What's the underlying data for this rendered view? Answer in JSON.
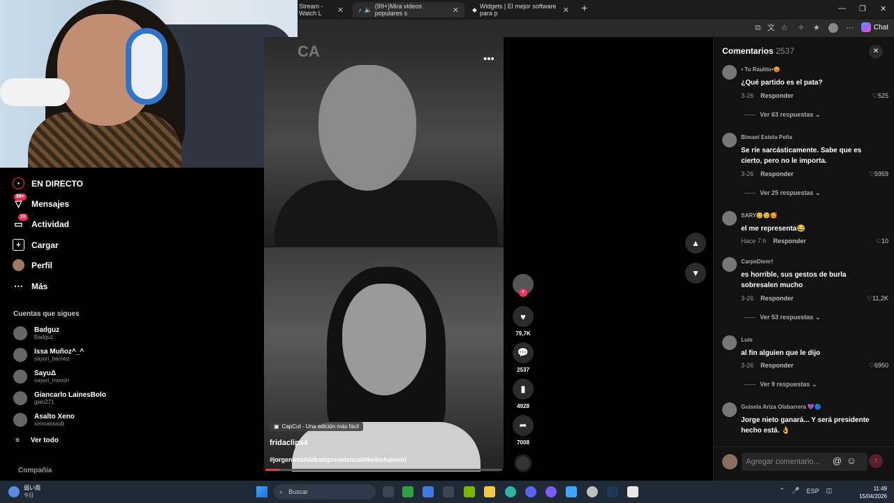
{
  "browser": {
    "tabs": [
      {
        "label": "Stream - Watch L"
      },
      {
        "label": "(99+)Mira videos populares s"
      },
      {
        "label": "Widgets | El mejor software para p"
      }
    ],
    "chat_label": "Chat"
  },
  "nav": {
    "items": [
      {
        "label": "EN DIRECTO",
        "icon": "live-icon",
        "badge": ""
      },
      {
        "label": "Mensajes",
        "icon": "message-icon",
        "badge": "99+"
      },
      {
        "label": "Actividad",
        "icon": "activity-icon",
        "badge": "15"
      },
      {
        "label": "Cargar",
        "icon": "upload-icon",
        "badge": ""
      },
      {
        "label": "Perfil",
        "icon": "profile-icon",
        "badge": ""
      },
      {
        "label": "Más",
        "icon": "more-icon",
        "badge": ""
      }
    ],
    "following_title": "Cuentas que sigues",
    "accounts": [
      {
        "name": "Badguz",
        "handle": "Badguz"
      },
      {
        "name": "Issa Muñoz^_^",
        "handle": "sayuri_barnez"
      },
      {
        "name": "SayuΔ",
        "handle": "sayuri_mooon"
      },
      {
        "name": "Giancarlo LainesBolo",
        "handle": "gian271"
      },
      {
        "name": "Asalto Xeno",
        "handle": "xenoassault"
      }
    ],
    "see_all": "Ver todo",
    "company": "Compañía"
  },
  "video": {
    "watermark": "CA",
    "capcut": "CapCut - Una edición más fácil",
    "author": "fridaclips4",
    "hashtags": "#jorgenieto#debatepresidencial#keikofujimori",
    "progress": 0.06
  },
  "actions": {
    "likes": "79,7K",
    "comments": "2537",
    "saves": "4928",
    "shares": "7008"
  },
  "comments": {
    "title": "Comentarios",
    "count": "2537",
    "items": [
      {
        "user": "• Tu Raulito•😡",
        "text": "¿Qué partido es el pata?",
        "time": "3-26",
        "reply": "Responder",
        "likes": "525",
        "replies": "Ver 63 respuestas"
      },
      {
        "user": "Bimael Estela Peña",
        "text": "Se ríe sarcásticamente. Sabe que es cierto, pero no le importa.",
        "time": "3-26",
        "reply": "Responder",
        "likes": "5959",
        "replies": "Ver 25 respuestas"
      },
      {
        "user": "SARY😊😊🥰",
        "text": "el me representa😂",
        "time": "Hace 7 h",
        "reply": "Responder",
        "likes": "10",
        "replies": ""
      },
      {
        "user": "CarpeDiem†",
        "text": "es horrible, sus gestos de burla sobresalen mucho",
        "time": "3-26",
        "reply": "Responder",
        "likes": "11,2K",
        "replies": "Ver 53 respuestas"
      },
      {
        "user": "Luis",
        "text": "al fin alguien que le dijo",
        "time": "3-26",
        "reply": "Responder",
        "likes": "6950",
        "replies": "Ver 9 respuestas"
      },
      {
        "user": "Guisela Ariza Olabarrera 💜🔵",
        "text": "Jorge nieto ganará... Y será presidente hecho está. 👌",
        "time": "",
        "reply": "",
        "likes": "",
        "replies": ""
      }
    ],
    "input_placeholder": "Agregar comentario..."
  },
  "taskbar": {
    "weather_temp": "弱い雨",
    "weather_day": "今日",
    "search_placeholder": "Buscar",
    "lang": "ESP",
    "time": "11:49",
    "date": "15/04/2026"
  }
}
